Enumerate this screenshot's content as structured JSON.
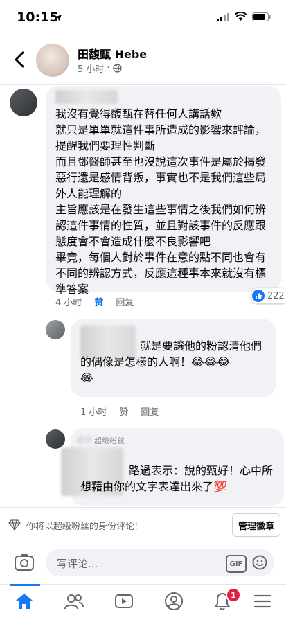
{
  "status": {
    "time": "10:15"
  },
  "post": {
    "author": "田馥甄 Hebe",
    "time": "5 小时"
  },
  "comments": [
    {
      "text": "我沒有覺得馥甄在替任何人講話欸\n就只是單單就這件事所造成的影響來評論，提醒我們要理性判斷\n而且鄧醫師甚至也沒說這次事件是屬於揭發惡行還是感情背叛，事實也不是我們這些局外人能理解的\n主旨應該是在發生這些事情之後我們如何辨認這件事情的性質，並且對該事件的反應跟態度會不會造成什麼不良影響吧\n畢竟，每個人對於事件在意的點不同也會有不同的辨認方式，反應這種事本來就沒有標準答案",
      "time": "4 小时",
      "like_label": "赞",
      "reply_label": "回复",
      "reactions": "222"
    },
    {
      "text": "就是要讓他的粉認清他們的偶像是怎樣的人啊！😂😂😂\n😂",
      "time": "1 小时",
      "like_label": "赞",
      "reply_label": "回复"
    },
    {
      "badge": "超级粉丝",
      "text": "路過表示：說的甄好！心中所想藉由你的文字表達出來了💯"
    }
  ],
  "fan_bar": {
    "text": "你将以超级粉丝的身份评论!",
    "button": "管理徽章"
  },
  "composer": {
    "placeholder": "写评论...",
    "gif": "GIF"
  },
  "tabs": {
    "notifications_badge": "1"
  },
  "colors": {
    "accent": "#1877f2",
    "badge": "#e41e3f"
  }
}
